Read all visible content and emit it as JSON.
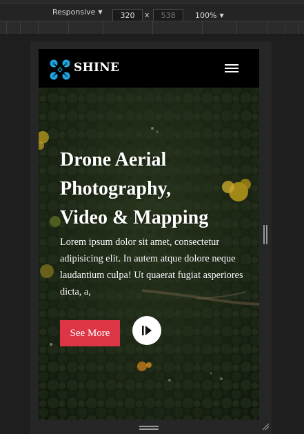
{
  "devtools": {
    "device_label": "Responsive",
    "width_value": "320",
    "height_value": "538",
    "dimension_separator": "x",
    "zoom_label": "100%"
  },
  "site": {
    "brand": "SHINE",
    "colors": {
      "accent": "#dc3545",
      "logo": "#1ea7e0",
      "nav_bg": "#000000"
    },
    "hero": {
      "title_lines": [
        "Drone Aerial",
        "Photography,",
        "Video & Mapping"
      ],
      "text": "Lorem ipsum dolor sit amet, consectetur adipisicing elit. In autem atque dolore neque laudantium culpa! Ut quaerat fugiat asperiores dicta, a,",
      "cta_label": "See More"
    },
    "icons": {
      "menu": "hamburger-icon",
      "play": "play-icon",
      "logo": "drone-logo-icon"
    }
  }
}
